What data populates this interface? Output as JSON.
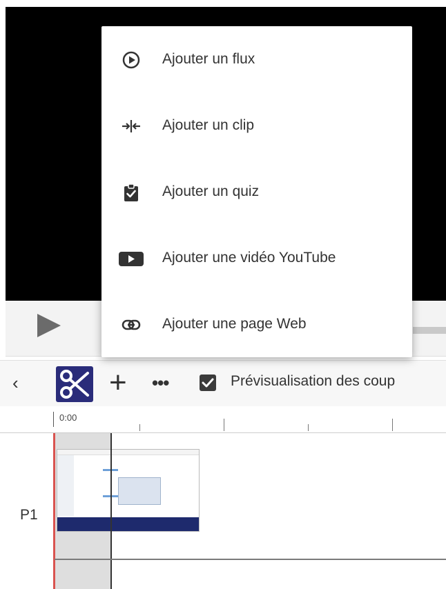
{
  "menu": {
    "items": [
      {
        "label": "Ajouter un flux",
        "icon": "play-circle-icon"
      },
      {
        "label": "Ajouter un clip",
        "icon": "insert-clip-icon"
      },
      {
        "label": "Ajouter un quiz",
        "icon": "clipboard-check-icon"
      },
      {
        "label": "Ajouter une vidéo YouTube",
        "icon": "youtube-icon"
      },
      {
        "label": "Ajouter une page Web",
        "icon": "link-icon"
      }
    ]
  },
  "toolbar": {
    "back_icon": "chevron-left-icon",
    "scissors_icon": "scissors-icon",
    "add_icon": "plus-icon",
    "more_icon": "more-horizontal-icon",
    "preview_checked": true,
    "preview_label": "Prévisualisation des coup"
  },
  "timeline": {
    "start_time": "0:00",
    "track_label": "P1"
  },
  "colors": {
    "scissors_bg": "#2a2c7a",
    "playhead_red": "#d9534f"
  }
}
